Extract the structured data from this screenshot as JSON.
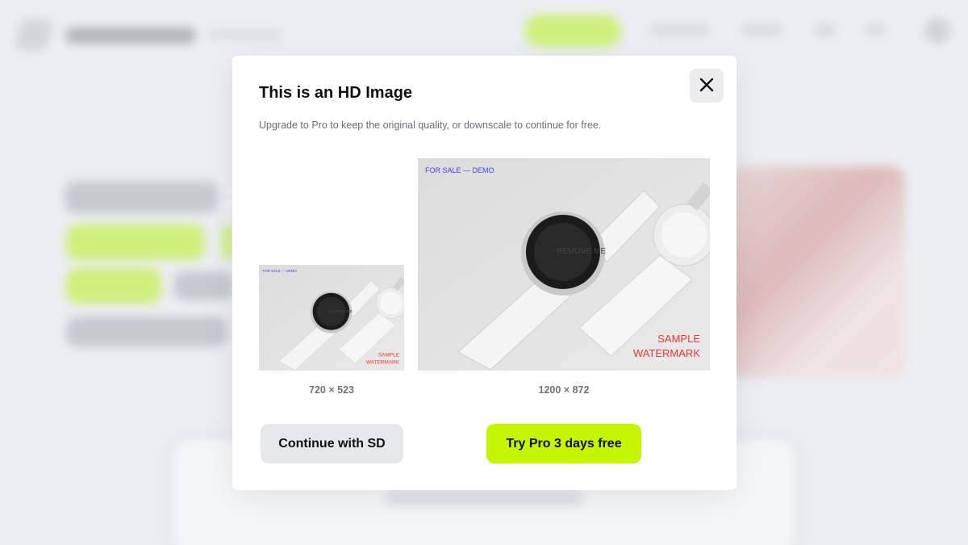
{
  "colors": {
    "accent": "#c6f500",
    "secondary_button": "#e6e7eb",
    "watermark": "#e53935",
    "demo_text": "#3f47e0"
  },
  "modal": {
    "title": "This is an HD Image",
    "subtitle": "Upgrade to Pro to keep the original quality, or downscale to continue for free.",
    "close_icon": "close-icon"
  },
  "previews": {
    "sd": {
      "size_label": "720 × 523"
    },
    "hd": {
      "size_label": "1200 × 872"
    },
    "image_text": {
      "demo_label": "FOR SALE — DEMO",
      "center_text": "REMOVE ME",
      "watermark_line1": "SAMPLE",
      "watermark_line2": "WATERMARK"
    }
  },
  "buttons": {
    "continue_sd": "Continue with SD",
    "try_pro": "Try Pro 3 days free"
  }
}
